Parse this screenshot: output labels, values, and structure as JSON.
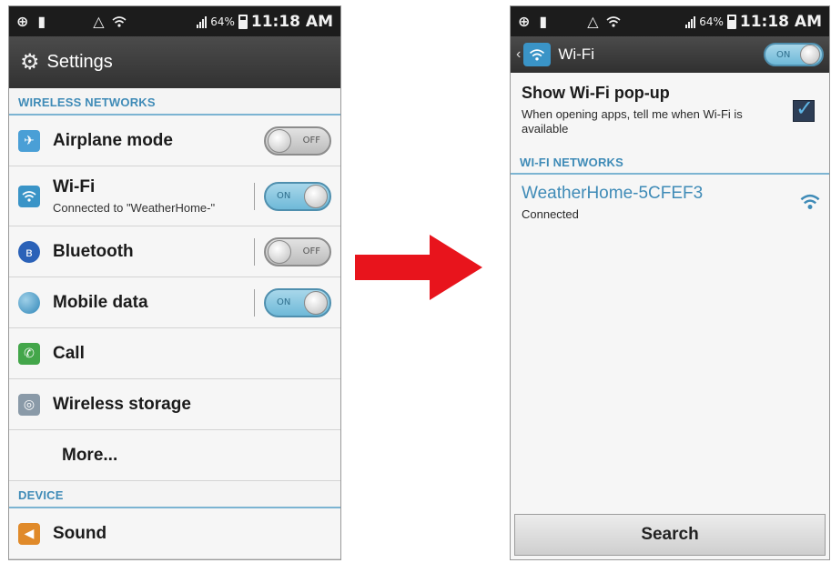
{
  "left_screen": {
    "status_bar": {
      "battery": "64%",
      "time": "11:18 AM"
    },
    "title_bar": {
      "icon": "gear-icon",
      "title": "Settings"
    },
    "sections": {
      "wireless": "WIRELESS NETWORKS",
      "device": "DEVICE"
    },
    "items": {
      "airplane": {
        "label": "Airplane mode",
        "icon": "airplane-icon",
        "toggle": "OFF"
      },
      "wifi": {
        "label": "Wi-Fi",
        "sublabel": "Connected to \"WeatherHome-\"",
        "icon": "wifi-icon",
        "toggle": "ON"
      },
      "bluetooth": {
        "label": "Bluetooth",
        "icon": "bluetooth-icon",
        "toggle": "OFF"
      },
      "mobile_data": {
        "label": "Mobile data",
        "icon": "globe-icon",
        "toggle": "ON"
      },
      "call": {
        "label": "Call",
        "icon": "phone-icon"
      },
      "wireless_storage": {
        "label": "Wireless storage",
        "icon": "wireless-storage-icon"
      },
      "more": {
        "label": "More..."
      },
      "sound": {
        "label": "Sound",
        "icon": "speaker-icon"
      }
    }
  },
  "arrow": {
    "color": "#e8141c",
    "icon": "right-arrow-icon"
  },
  "right_screen": {
    "status_bar": {
      "battery": "64%",
      "time": "11:18 AM"
    },
    "title_bar": {
      "title": "Wi-Fi",
      "toggle": "ON"
    },
    "popup_setting": {
      "title": "Show Wi-Fi pop-up",
      "description": "When opening apps, tell me when Wi-Fi is available",
      "checked": true
    },
    "section": "WI-FI NETWORKS",
    "network": {
      "name": "WeatherHome-5CFEF3",
      "status": "Connected",
      "icon": "wifi-signal-icon"
    },
    "search_button": "Search"
  },
  "colors": {
    "accent_blue": "#3f8bb7",
    "status_bar": "#1c1c1c",
    "title_bar": "#3a3a3a",
    "toggle_on": "#6fb9d8"
  }
}
